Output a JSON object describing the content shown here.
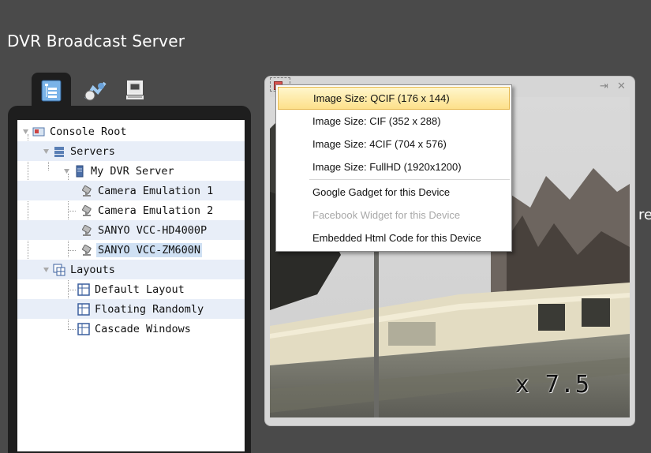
{
  "app": {
    "title": "DVR Broadcast Server"
  },
  "tabs": [
    {
      "name": "tree-view",
      "icon": "tree-view-icon",
      "active": true
    },
    {
      "name": "publish",
      "icon": "broadcast-icon",
      "active": false
    },
    {
      "name": "computer",
      "icon": "computer-icon",
      "active": false
    }
  ],
  "tree": {
    "root": "Console Root",
    "servers": "Servers",
    "server": "My DVR Server",
    "devices": [
      "Camera Emulation 1",
      "Camera Emulation 2",
      "SANYO VCC-HD4000P",
      "SANYO VCC-ZM600N"
    ],
    "layouts": "Layouts",
    "layout_items": [
      "Default Layout",
      "Floating Randomly",
      "Cascade Windows"
    ]
  },
  "video": {
    "zoom_text": "x 7.5",
    "pin_icon": "pin-icon",
    "close_icon": "close-icon"
  },
  "edge_text": "rec",
  "context_menu": {
    "items": [
      {
        "label": "Image Size: QCIF (176 x 144)",
        "state": "hover"
      },
      {
        "label": "Image Size: CIF (352 x 288)",
        "state": "normal"
      },
      {
        "label": "Image Size: 4CIF (704 x 576)",
        "state": "normal"
      },
      {
        "label": "Image Size: FullHD (1920x1200)",
        "state": "normal"
      },
      {
        "label": "Google Gadget for this Device",
        "state": "normal"
      },
      {
        "label": "Facebook Widget for this Device",
        "state": "disabled"
      },
      {
        "label": "Embedded Html Code for this Device",
        "state": "normal"
      }
    ]
  },
  "colors": {
    "background": "#4a4a4a",
    "panel": "#1e1e1e",
    "hover": "#fde08a",
    "selection": "#cfe0f3"
  }
}
